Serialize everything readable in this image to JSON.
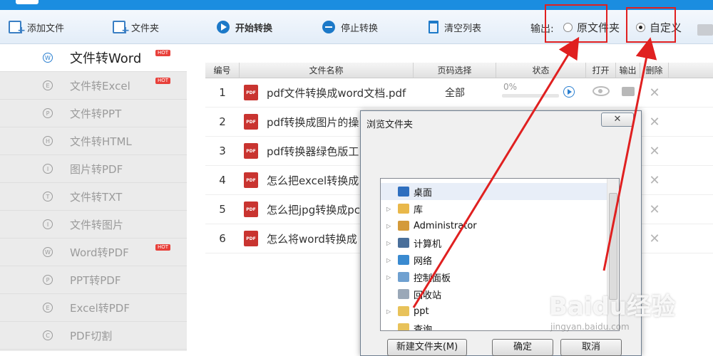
{
  "toolbar": {
    "add_file": "添加文件",
    "folder": "文件夹",
    "start": "开始转换",
    "stop": "停止转换",
    "clear": "清空列表",
    "output_label": "输出:",
    "opt_original": "原文件夹",
    "opt_custom": "自定义",
    "selected_option": "自定义"
  },
  "sidebar": {
    "items": [
      {
        "label": "文件转Word",
        "icon": "W",
        "hot": "HOT"
      },
      {
        "label": "文件转Excel",
        "icon": "E",
        "hot": "HOT"
      },
      {
        "label": "文件转PPT",
        "icon": "P",
        "hot": ""
      },
      {
        "label": "文件转HTML",
        "icon": "H",
        "hot": ""
      },
      {
        "label": "图片转PDF",
        "icon": "I",
        "hot": ""
      },
      {
        "label": "文件转TXT",
        "icon": "T",
        "hot": ""
      },
      {
        "label": "文件转图片",
        "icon": "I",
        "hot": ""
      },
      {
        "label": "Word转PDF",
        "icon": "W",
        "hot": "HOT"
      },
      {
        "label": "PPT转PDF",
        "icon": "P",
        "hot": ""
      },
      {
        "label": "Excel转PDF",
        "icon": "E",
        "hot": ""
      },
      {
        "label": "PDF切割",
        "icon": "C",
        "hot": ""
      }
    ]
  },
  "table": {
    "headers": [
      "编号",
      "文件名称",
      "页码选择",
      "状态",
      "打开",
      "输出",
      "删除"
    ],
    "rows": [
      {
        "no": "1",
        "name": "pdf文件转换成word文档.pdf",
        "pages": "全部",
        "progress": "0%",
        "progress_value": 0
      },
      {
        "no": "2",
        "name": "pdf转换成图片的操",
        "pages": "",
        "progress": "",
        "progress_value": 0
      },
      {
        "no": "3",
        "name": "pdf转换器绿色版工",
        "pages": "",
        "progress": "",
        "progress_value": 0
      },
      {
        "no": "4",
        "name": "怎么把excel转换成",
        "pages": "",
        "progress": "",
        "progress_value": 0
      },
      {
        "no": "5",
        "name": "怎么把jpg转换成pc",
        "pages": "",
        "progress": "",
        "progress_value": 0
      },
      {
        "no": "6",
        "name": "怎么将word转换成",
        "pages": "",
        "progress": "",
        "progress_value": 0
      }
    ]
  },
  "dialog": {
    "title": "浏览文件夹",
    "close": "✕",
    "tree": [
      {
        "label": "桌面",
        "expand": false,
        "icon_color": "#2f6fbf",
        "selected": true
      },
      {
        "label": "库",
        "expand": true,
        "icon_color": "#e9b84a",
        "selected": false
      },
      {
        "label": "Administrator",
        "expand": true,
        "icon_color": "#d49a3a",
        "selected": false
      },
      {
        "label": "计算机",
        "expand": true,
        "icon_color": "#4a6f9a",
        "selected": false
      },
      {
        "label": "网络",
        "expand": true,
        "icon_color": "#3a8ad0",
        "selected": false
      },
      {
        "label": "控制面板",
        "expand": true,
        "icon_color": "#6fa0d0",
        "selected": false
      },
      {
        "label": "回收站",
        "expand": false,
        "icon_color": "#9aa8b8",
        "selected": false
      },
      {
        "label": "ppt",
        "expand": true,
        "icon_color": "#e8c25a",
        "selected": false
      },
      {
        "label": "查询",
        "expand": false,
        "icon_color": "#e8c25a",
        "selected": false
      }
    ],
    "new_folder": "新建文件夹(M)",
    "ok": "确定",
    "cancel": "取消"
  },
  "watermark": {
    "main": "Baidu经验",
    "sub": "jingyan.baidu.com"
  },
  "colors": {
    "accent": "#1b8de0",
    "annotation": "#e02020",
    "hot_badge": "#e8403a",
    "pdf_icon": "#c93430"
  }
}
